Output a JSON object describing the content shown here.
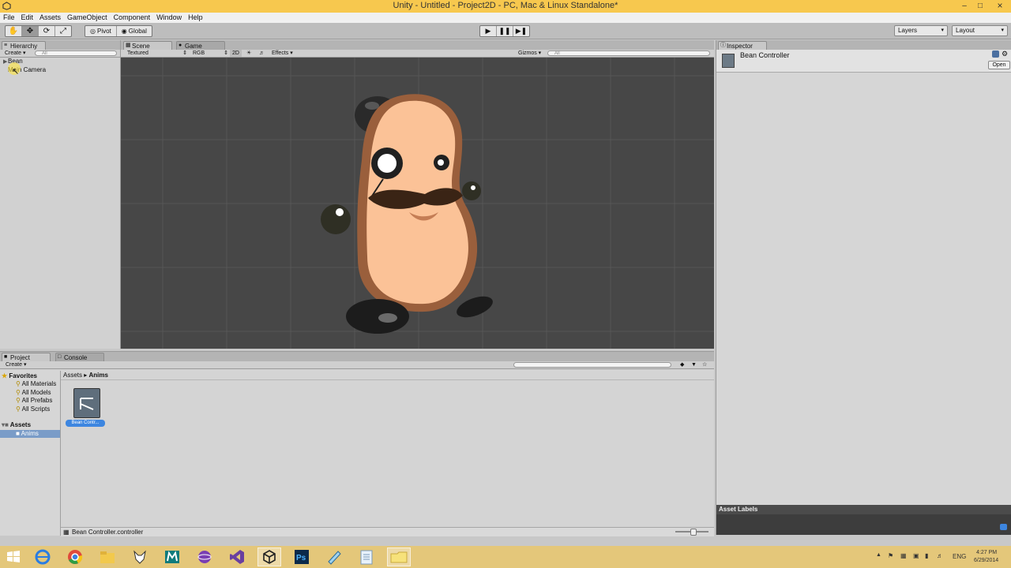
{
  "window": {
    "title": "Unity - Untitled - Project2D - PC, Mac & Linux Standalone*"
  },
  "menu": [
    "File",
    "Edit",
    "Assets",
    "GameObject",
    "Component",
    "Window",
    "Help"
  ],
  "toolbar": {
    "pivot": "Pivot",
    "global": "Global",
    "layers": "Layers",
    "layout": "Layout"
  },
  "hierarchy": {
    "tab": "Hierarchy",
    "create": "Create",
    "search_placeholder": "All",
    "items": [
      "Bean",
      "Main Camera"
    ]
  },
  "scene": {
    "tabs": [
      "Scene",
      "Game"
    ],
    "shading": "Textured",
    "render_mode": "RGB",
    "mode_2d": "2D",
    "effects": "Effects",
    "gizmos": "Gizmos",
    "search_placeholder": "All"
  },
  "inspector": {
    "tab": "Inspector",
    "object_name": "Bean Controller",
    "open": "Open",
    "asset_labels": "Asset Labels"
  },
  "project": {
    "tabs": [
      "Project",
      "Console"
    ],
    "create": "Create",
    "breadcrumb": [
      "Assets",
      "Anims"
    ],
    "favorites_label": "Favorites",
    "favorites": [
      "All Materials",
      "All Models",
      "All Prefabs",
      "All Scripts"
    ],
    "assets_label": "Assets",
    "assets_children": [
      "Anims"
    ],
    "asset_items": [
      {
        "name": "Bean Contr..."
      }
    ],
    "selected_path": "Bean Controller.controller"
  },
  "taskbar": {
    "lang": "ENG",
    "time": "4:27 PM",
    "date": "6/29/2014"
  },
  "colors": {
    "title": "#f7c84e",
    "scene_bg": "#474747",
    "bean_skin": "#fbc297",
    "selection": "#3d86e0"
  }
}
